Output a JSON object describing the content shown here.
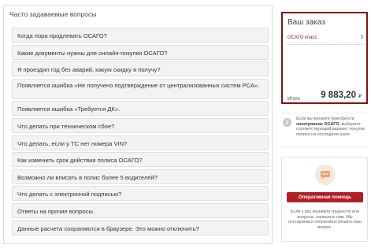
{
  "faq": {
    "title": "Часто задаваемые вопросы",
    "items": [
      "Когда пора продлевать ОСАГО?",
      "Какие документы нужны для онлайн-покупки ОСАГО?",
      "Я проездил год без аварий, какую скидку я получу?",
      "Появляется ошибка «Не получено подтверждение от централизованных систем РСА».",
      "Появляется ошибка «Требуется ДК».",
      "Что делать при техническом сбое?",
      "Что делать, если у ТС нет номера VIN?",
      "Как изменить срок действия полиса ОСАГО?",
      "Возможно ли вписать в полис более 5 водителей?",
      "Что делать с электронной подписью?",
      "Ответы на прочие вопросы.",
      "Данные расчета сохраняются в браузере. Это можно отключить?"
    ]
  },
  "order": {
    "title": "Ваш заказ",
    "item_label": "ОСАГО класс",
    "item_qty": "3",
    "total_label": "Итого",
    "total_value": "9 883,20",
    "currency": "₽"
  },
  "info": {
    "icon": "i",
    "text_before": "Если вы желаете приобрести ",
    "text_bold": "электронное ОСАГО",
    "text_after": ", выберите соответствующий вариант покупки полиса на последнем шаге."
  },
  "help": {
    "icon": "chat-bubble-icon",
    "button_label": "Оперативная помощь",
    "text": "Если у вас возникли трудности или вопросы, напишите нам. Мы постараемся оперативно решить ваш вопрос."
  },
  "colors": {
    "accent": "#b01f23",
    "order_border": "#7a1717",
    "item_bg": "#f3f3f3"
  }
}
